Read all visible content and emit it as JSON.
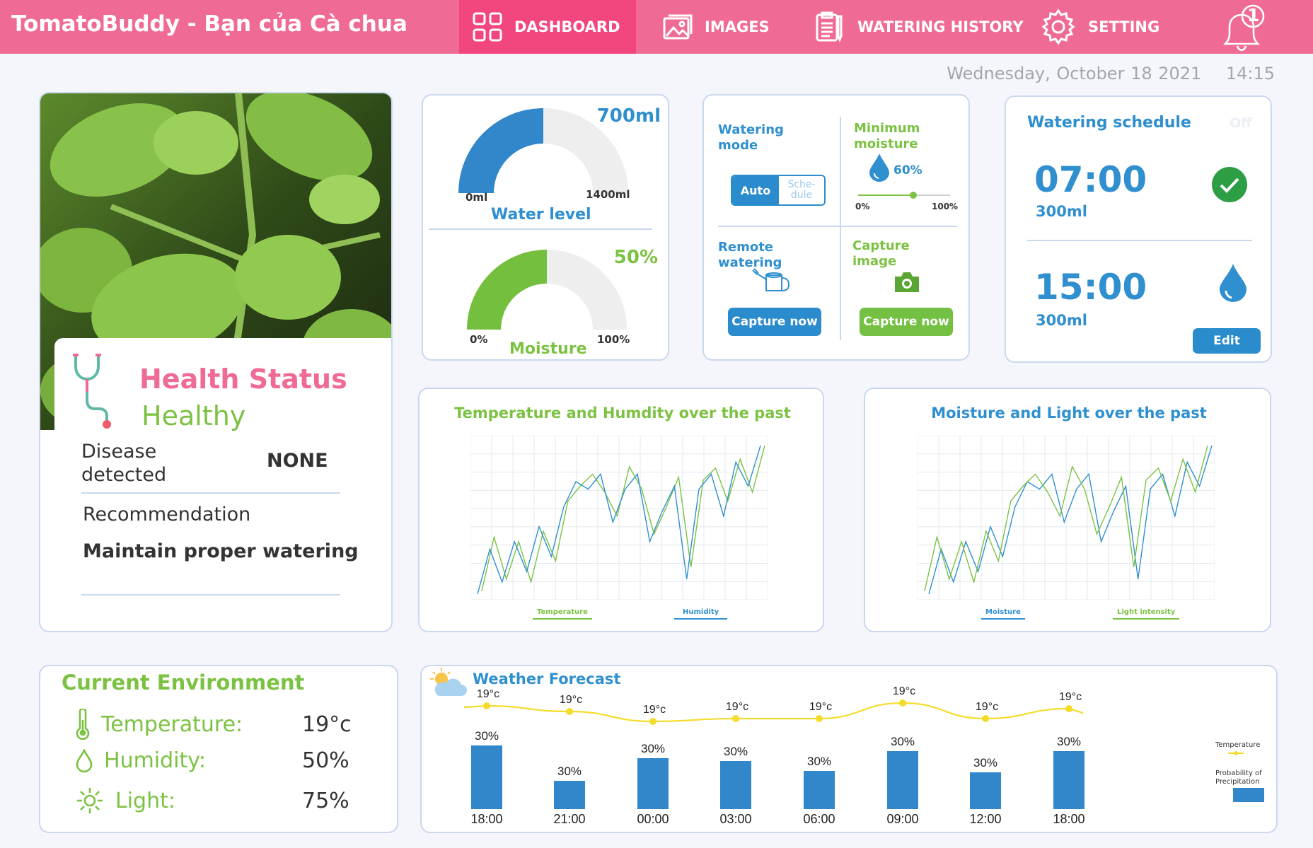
{
  "app": {
    "title": "TomatoBuddy - Bạn của Cà chua"
  },
  "nav": {
    "items": [
      {
        "label": "DASHBOARD",
        "icon": "grid-icon"
      },
      {
        "label": "IMAGES",
        "icon": "image-icon"
      },
      {
        "label": "WATERING HISTORY",
        "icon": "clipboard-icon"
      },
      {
        "label": "SETTING",
        "icon": "gear-icon"
      }
    ],
    "notifications": "1"
  },
  "datetime": "Wednesday, October 18 2021    14:15",
  "health": {
    "title": "Health Status",
    "status": "Healthy",
    "disease_label_1": "Disease",
    "disease_label_2": "detected",
    "disease_value": "NONE",
    "recommendation_label": "Recommendation",
    "recommendation": "Maintain proper watering"
  },
  "water": {
    "current": "700ml",
    "min": "0ml",
    "max": "1400ml",
    "label": "Water level",
    "fraction": 0.5
  },
  "moisture": {
    "current": "50%",
    "min": "0%",
    "max": "100%",
    "label": "Moisture",
    "fraction": 0.5
  },
  "controls": {
    "watering_mode_1": "Watering",
    "watering_mode_2": "mode",
    "mode_auto": "Auto",
    "mode_schedule_1": "Sche-",
    "mode_schedule_2": "dule",
    "min_moisture_1": "Minimum",
    "min_moisture_2": "moisture",
    "min_moisture_value": "60%",
    "slider_min": "0%",
    "slider_max": "100%",
    "slider_level": 0.6,
    "remote_1": "Remote",
    "remote_2": "watering",
    "capture_1": "Capture",
    "capture_2": "image",
    "remote_button": "Capture now",
    "capture_button": "Capture now"
  },
  "schedule": {
    "title": "Watering schedule",
    "toggle": "Off",
    "items": [
      {
        "time": "07:00",
        "amount": "300ml",
        "status": "check-icon"
      },
      {
        "time": "15:00",
        "amount": "300ml",
        "status": "water-drop-icon"
      }
    ],
    "edit": "Edit"
  },
  "chart1": {
    "title": "Temperature and Humdity over the past",
    "legend": [
      "Temperature",
      "Humidity"
    ]
  },
  "chart2": {
    "title": "Moisture and Light over the past",
    "legend": [
      "Moisture",
      "Light intensity"
    ]
  },
  "environment": {
    "title": "Current Environment",
    "rows": [
      {
        "label": "Temperature:",
        "value": "19°c",
        "icon": "thermometer-icon"
      },
      {
        "label": "Humidity:",
        "value": "50%",
        "icon": "droplet-icon"
      },
      {
        "label": "Light:",
        "value": "75%",
        "icon": "sun-icon"
      }
    ]
  },
  "weather": {
    "title": "Weather Forecast",
    "legend_temp": "Temperature",
    "legend_precip_1": "Probability of",
    "legend_precip_2": "Precipitation"
  },
  "chart_data": [
    {
      "type": "line",
      "title": "Temperature and Humdity over the past",
      "series": [
        {
          "name": "Temperature",
          "color": "#7cc242",
          "values": [
            2,
            38,
            10,
            35,
            8,
            42,
            22,
            62,
            72,
            80,
            68,
            52,
            85,
            70,
            40,
            58,
            78,
            18,
            76,
            84,
            62,
            90,
            68,
            99
          ]
        },
        {
          "name": "Humidity",
          "color": "#2f8fcf",
          "values": [
            0,
            30,
            8,
            35,
            15,
            45,
            25,
            58,
            75,
            70,
            80,
            48,
            70,
            80,
            35,
            55,
            72,
            10,
            70,
            80,
            52,
            88,
            72,
            99
          ]
        }
      ],
      "ylim": [
        0,
        100
      ]
    },
    {
      "type": "line",
      "title": "Moisture and Light over the past",
      "series": [
        {
          "name": "Moisture",
          "color": "#2f8fcf",
          "values": [
            0,
            30,
            8,
            35,
            15,
            45,
            25,
            58,
            75,
            70,
            80,
            48,
            70,
            80,
            35,
            55,
            72,
            10,
            70,
            80,
            52,
            88,
            72,
            99
          ]
        },
        {
          "name": "Light intensity",
          "color": "#7cc242",
          "values": [
            2,
            38,
            10,
            35,
            8,
            42,
            22,
            62,
            72,
            80,
            68,
            52,
            85,
            70,
            40,
            58,
            78,
            18,
            76,
            84,
            62,
            90,
            68,
            99
          ]
        }
      ],
      "ylim": [
        0,
        100
      ]
    },
    {
      "type": "bar",
      "title": "Weather Forecast",
      "categories": [
        "18:00",
        "21:00",
        "00:00",
        "03:00",
        "06:00",
        "09:00",
        "12:00",
        "18:00"
      ],
      "series": [
        {
          "name": "Probability of Precipitation",
          "bar_labels": [
            "30%",
            "30%",
            "30%",
            "30%",
            "30%",
            "30%",
            "30%",
            "30%"
          ],
          "values": [
            30,
            30,
            30,
            30,
            30,
            30,
            30,
            30
          ]
        },
        {
          "name": "Temperature",
          "point_labels": [
            "19°c",
            "19°c",
            "19°c",
            "19°c",
            "19°c",
            "19°c",
            "19°c",
            "19°c"
          ],
          "values": [
            19,
            19,
            19,
            19,
            19,
            19,
            19,
            19
          ]
        }
      ]
    }
  ]
}
